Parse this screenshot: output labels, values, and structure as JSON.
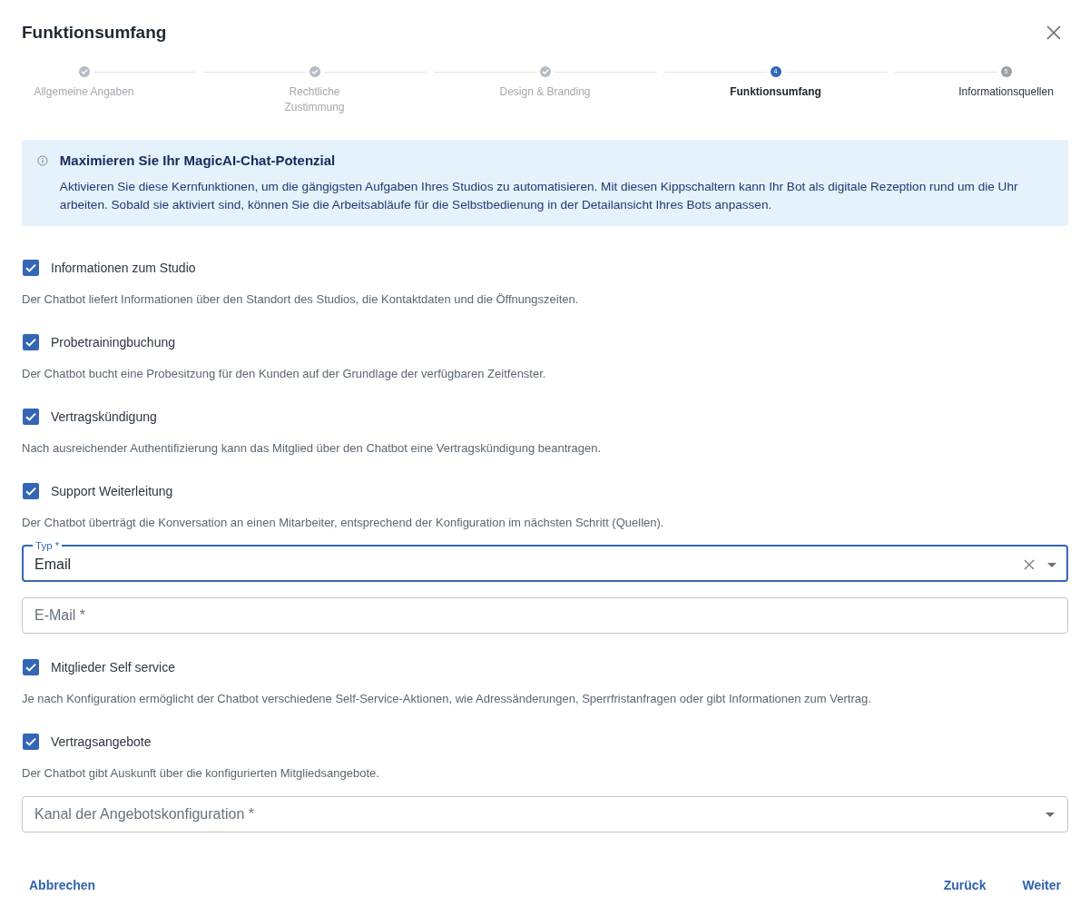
{
  "dialog": {
    "title": "Funktionsumfang"
  },
  "stepper": {
    "steps": [
      {
        "label": "Allgemeine Angaben",
        "completed": true,
        "selected": false
      },
      {
        "label": "Rechtliche Zustimmung",
        "completed": true,
        "selected": false
      },
      {
        "label": "Design & Branding",
        "completed": true,
        "selected": false
      },
      {
        "label": "Funktionsumfang",
        "number": "4",
        "completed": false,
        "selected": true
      },
      {
        "label": "Informationsquellen",
        "number": "5",
        "completed": false,
        "selected": false
      }
    ]
  },
  "banner": {
    "title": "Maximieren Sie Ihr MagicAI-Chat-Potenzial",
    "text": "Aktivieren Sie diese Kernfunktionen, um die gängigsten Aufgaben Ihres Studios zu automatisieren. Mit diesen Kippschaltern kann Ihr Bot als digitale Rezeption rund um die Uhr arbeiten. Sobald sie aktiviert sind, können Sie die Arbeitsabläufe für die Selbstbedienung in der Detailansicht Ihres Bots anpassen."
  },
  "features": [
    {
      "label": "Informationen zum Studio",
      "checked": true,
      "description": "Der Chatbot liefert Informationen über den Standort des Studios, die Kontaktdaten und die Öffnungszeiten."
    },
    {
      "label": "Probetrainingbuchung",
      "checked": true,
      "description": "Der Chatbot bucht eine Probesitzung für den Kunden auf der Grundlage der verfügbaren Zeitfenster."
    },
    {
      "label": "Vertragskündigung",
      "checked": true,
      "description": "Nach ausreichender Authentifizierung kann das Mitglied über den Chatbot eine Vertragskündigung beantragen."
    },
    {
      "label": "Support Weiterleitung",
      "checked": true,
      "description": "Der Chatbot überträgt die Konversation an einen Mitarbeiter, entsprechend der Konfiguration im nächsten Schritt (Quellen).",
      "fields": [
        {
          "kind": "select",
          "label": "Typ *",
          "value": "Email",
          "focused": true
        },
        {
          "kind": "input",
          "placeholder": "E-Mail *"
        }
      ]
    },
    {
      "label": "Mitglieder Self service",
      "checked": true,
      "description": "Je nach Konfiguration ermöglicht der Chatbot verschiedene Self-Service-Aktionen, wie Adressänderungen, Sperrfristanfragen oder gibt Informationen zum Vertrag."
    },
    {
      "label": "Vertragsangebote",
      "checked": true,
      "description": "Der Chatbot gibt Auskunft über die konfigurierten Mitgliedsangebote.",
      "fields": [
        {
          "kind": "select",
          "placeholder": "Kanal der Angebotskonfiguration *"
        }
      ]
    }
  ],
  "footer": {
    "cancel": "Abbrechen",
    "back": "Zurück",
    "next": "Weiter"
  }
}
